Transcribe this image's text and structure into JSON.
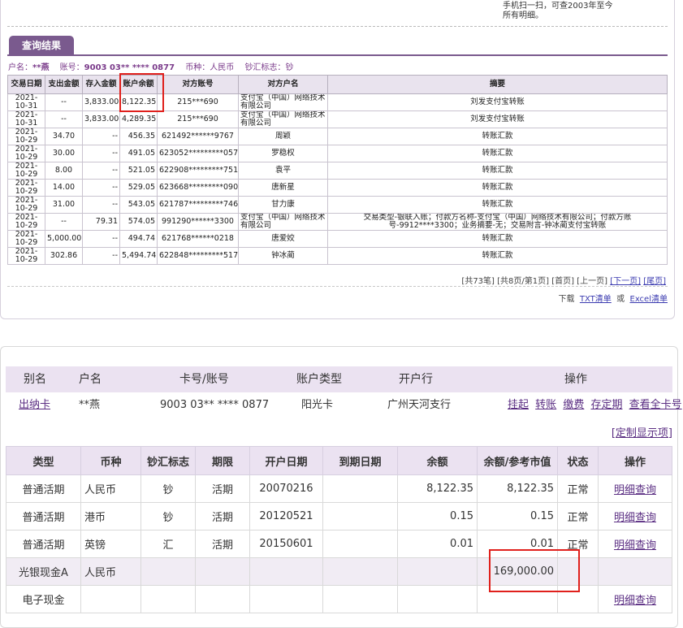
{
  "hint": {
    "line1": "手机扫一扫，可查2003年至今",
    "line2": "所有明细。"
  },
  "result_tab": "查询结果",
  "account_info": {
    "name_label": "户名：",
    "name": "**燕",
    "acct_label": "账号：",
    "acct": "9003 03** **** 0877",
    "currency_label": "币种：",
    "currency": "人民币",
    "flag_label": "钞汇标志：",
    "flag": "钞"
  },
  "tx_table": {
    "headers": [
      "交易日期",
      "支出金额",
      "存入金额",
      "账户余额",
      "对方账号",
      "对方户名",
      "摘要"
    ],
    "rows": [
      [
        "2021-10-31",
        "--",
        "3,833.00",
        "8,122.35",
        "215***690",
        "支付宝（中国）网络技术有限公司",
        "刘发支付宝转账"
      ],
      [
        "2021-10-31",
        "--",
        "3,833.00",
        "4,289.35",
        "215***690",
        "支付宝（中国）网络技术有限公司",
        "刘发支付宝转账"
      ],
      [
        "2021-10-29",
        "34.70",
        "--",
        "456.35",
        "621492******9767",
        "周颖",
        "转账汇款"
      ],
      [
        "2021-10-29",
        "30.00",
        "--",
        "491.05",
        "623052*********0570",
        "罗稳权",
        "转账汇款"
      ],
      [
        "2021-10-29",
        "8.00",
        "--",
        "521.05",
        "622908*********7519",
        "袁平",
        "转账汇款"
      ],
      [
        "2021-10-29",
        "14.00",
        "--",
        "529.05",
        "623668*********0901",
        "唐新星",
        "转账汇款"
      ],
      [
        "2021-10-29",
        "31.00",
        "--",
        "543.05",
        "621787*********7463",
        "甘力康",
        "转账汇款"
      ],
      [
        "2021-10-29",
        "--",
        "79.31",
        "574.05",
        "991290******3300",
        "支付宝（中国）网络技术有限公司",
        "交易类型-银联入账；付款方名称-支付宝（中国）网络技术有限公司；付款方账号-9912****3300；业务摘要-无；交易附言-钟冰蔺支付宝转账"
      ],
      [
        "2021-10-29",
        "5,000.00",
        "--",
        "494.74",
        "621768******0218",
        "唐爱姣",
        "转账汇款"
      ],
      [
        "2021-10-29",
        "302.86",
        "--",
        "5,494.74",
        "622848*********5179",
        "钟冰蔺",
        "转账汇款"
      ]
    ]
  },
  "pager": {
    "info": "[共73笔] [共8页/第1页] [首页] [上一页]",
    "next": "[下一页]",
    "last": "[尾页]"
  },
  "downloads": {
    "label": "下载",
    "txt": "TXT清单",
    "or": "或",
    "excel": "Excel清单"
  },
  "card": {
    "headers": [
      "别名",
      "户名",
      "卡号/账号",
      "账户类型",
      "开户行",
      "操作"
    ],
    "alias": "出纳卡",
    "name": "**燕",
    "number": "9003 03** **** 0877",
    "type": "阳光卡",
    "branch": "广州天河支行",
    "actions": [
      "挂起",
      "转账",
      "缴费",
      "存定期",
      "查看全卡号"
    ]
  },
  "custom_display": "[定制显示项]",
  "acc_table": {
    "headers": [
      "类型",
      "币种",
      "钞汇标志",
      "期限",
      "开户日期",
      "到期日期",
      "余额",
      "余额/参考市值",
      "状态",
      "操作"
    ],
    "rows": [
      [
        "普通活期",
        "人民币",
        "钞",
        "活期",
        "20070216",
        "",
        "8,122.35",
        "8,122.35",
        "正常",
        "明细查询"
      ],
      [
        "普通活期",
        "港币",
        "钞",
        "活期",
        "20120521",
        "",
        "0.15",
        "0.15",
        "正常",
        "明细查询"
      ],
      [
        "普通活期",
        "英镑",
        "汇",
        "活期",
        "20150601",
        "",
        "0.01",
        "0.01",
        "正常",
        "明细查询"
      ],
      [
        "光银现金A",
        "人民币",
        "",
        "",
        "",
        "",
        "",
        "169,000.00",
        "",
        ""
      ],
      [
        "电子现金",
        "",
        "",
        "",
        "",
        "",
        "",
        "",
        "",
        "明细查询"
      ]
    ]
  },
  "colors": {
    "accent": "#7a5a8e",
    "header_bg": "#ebe2f1",
    "highlight": "#e0201c",
    "link": "#5a2d82"
  }
}
